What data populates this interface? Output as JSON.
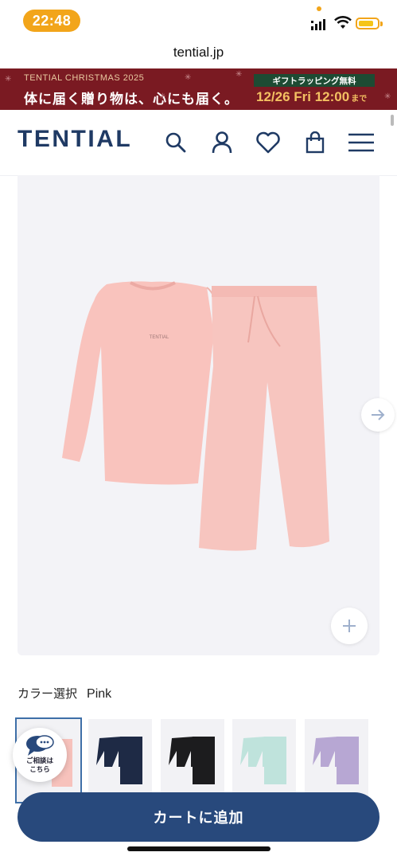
{
  "status_bar": {
    "time": "22:48"
  },
  "url": "tential.jp",
  "banner": {
    "subtitle": "TENTIAL CHRISTMAS 2025",
    "headline": "体に届く贈り物は、心にも届く。",
    "gift_badge": "ギフトラッピング無料",
    "deadline": "12/26 Fri  12:00",
    "deadline_suffix": "まで",
    "colors": {
      "background": "#7a1a22",
      "badge": "#1d4b33",
      "date": "#f3c062"
    }
  },
  "header": {
    "logo": "TENTIAL",
    "icons": [
      "search-icon",
      "account-icon",
      "favorite-icon",
      "cart-icon",
      "menu-icon"
    ]
  },
  "product": {
    "image_alt": "pink pajama set",
    "color_label": "カラー選択",
    "selected_color": "Pink",
    "swatches": [
      {
        "color": "Pink",
        "hex": "#f7c2bc",
        "selected": true
      },
      {
        "color": "Navy",
        "hex": "#1e2a45"
      },
      {
        "color": "Black",
        "hex": "#1c1c1e"
      },
      {
        "color": "Mint",
        "hex": "#bfe3dc"
      },
      {
        "color": "Lavender",
        "hex": "#b7a7d3"
      }
    ]
  },
  "chat": {
    "label_line1": "ご相談は",
    "label_line2": "こちら"
  },
  "cart": {
    "label": "カートに追加",
    "color": "#28497c"
  }
}
